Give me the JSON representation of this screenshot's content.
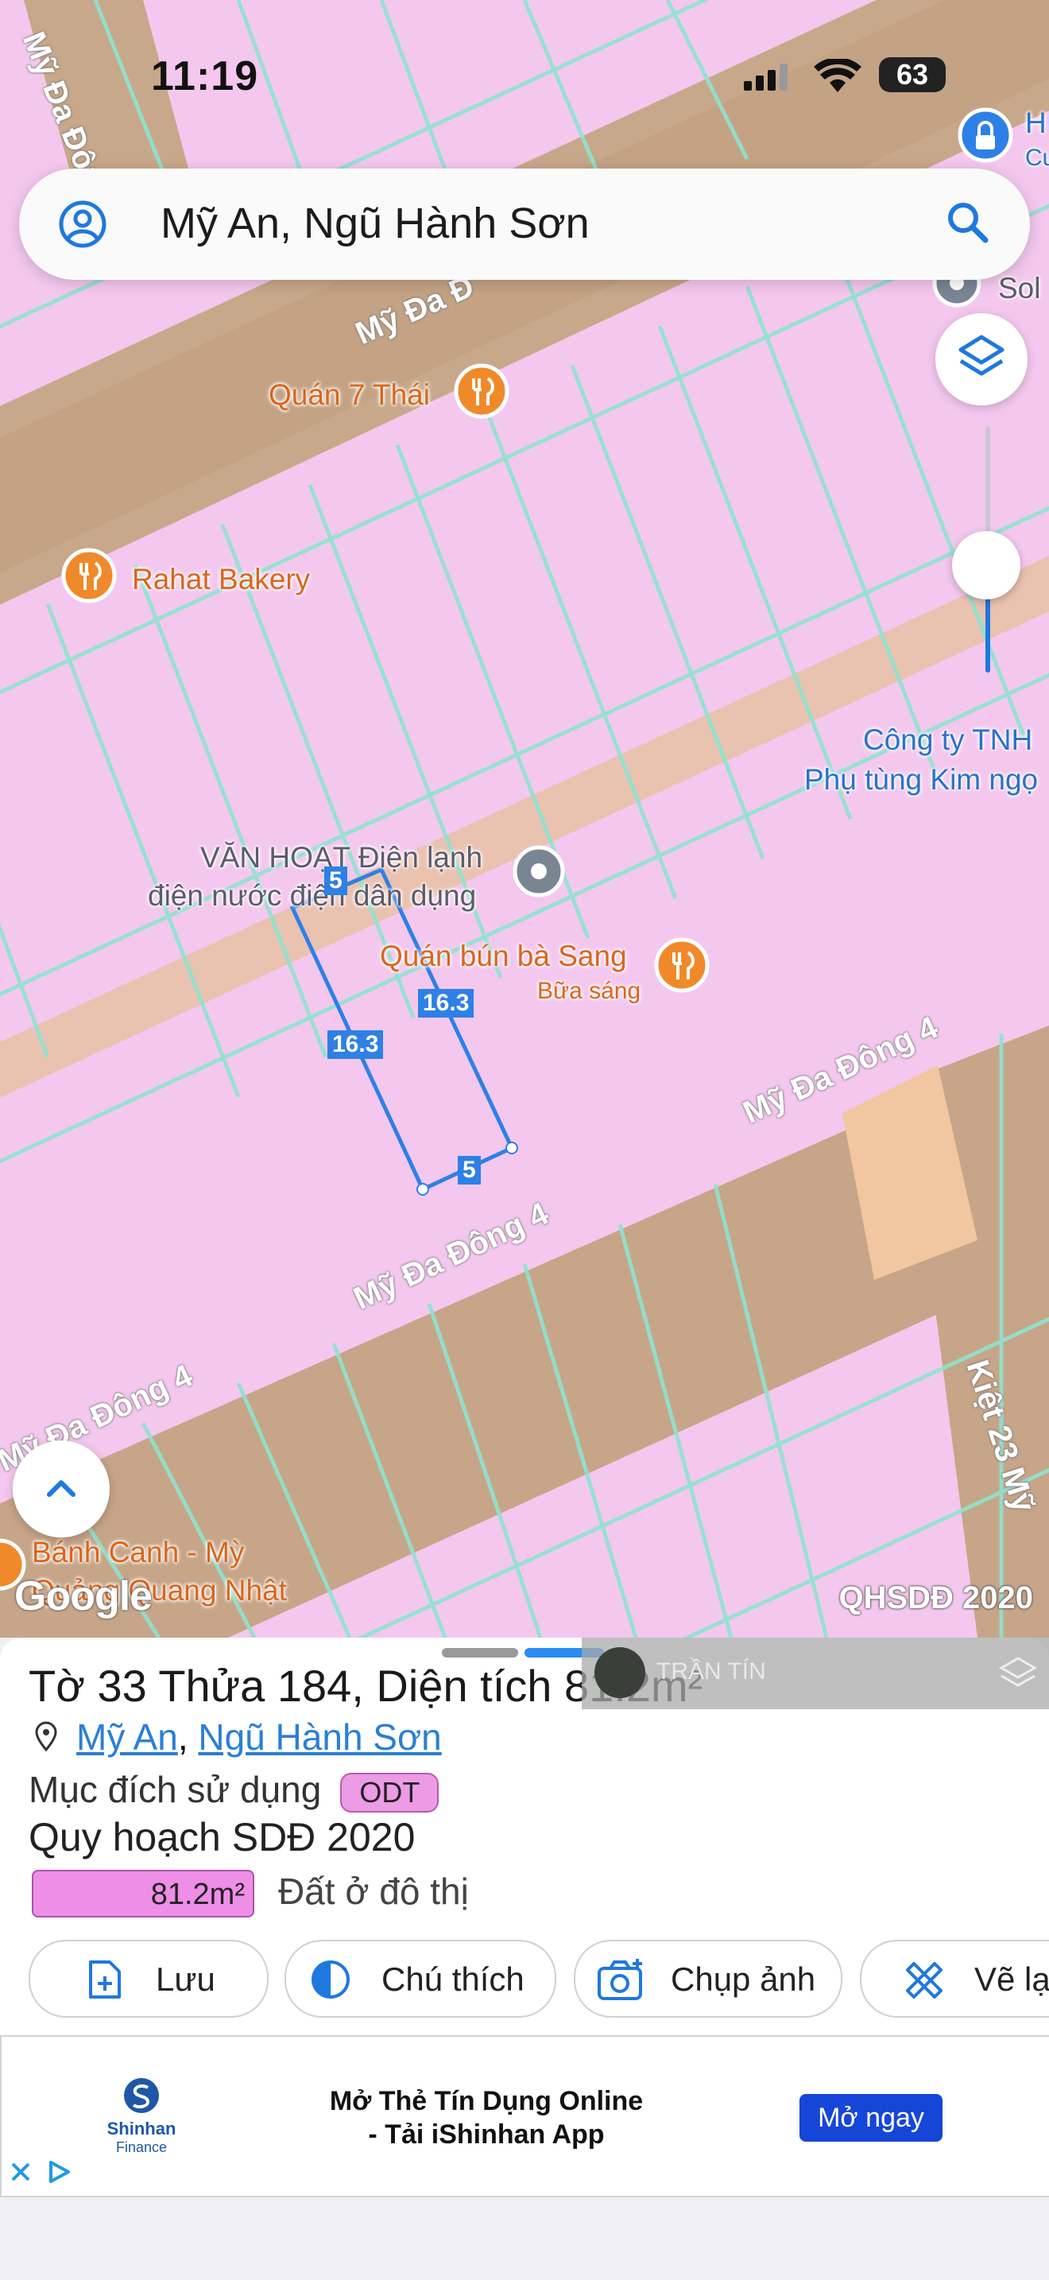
{
  "status_bar": {
    "time": "11:19",
    "battery": "63"
  },
  "search": {
    "query": "Mỹ An, Ngũ Hành Sơn"
  },
  "map": {
    "pois": {
      "quan7thai": "Quán 7 Thái",
      "rahat": "Rahat Bakery",
      "vanhoat_line1": "VĂN HOẠT Điện lạnh",
      "vanhoat_line2": "điện nước điện dân dụng",
      "bunbasang": "Quán bún bà Sang",
      "bunbasang_sub": "Bữa sáng",
      "congty_line1": "Công ty TNH",
      "congty_line2": "Phụ tùng Kim ngọ",
      "banhcanh_line1": "Bánh Canh - Mỳ",
      "banhcanh_line2": "Quảng Quang Nhật",
      "top_right_1": "H",
      "top_right_2": "Cu",
      "sol": "Sol"
    },
    "roads": {
      "myda_top": "Mỹ Đa Đ",
      "myda_left": "Mỹ Đa Đông",
      "mydadong4_a": "Mỹ Đa Đông 4",
      "mydadong4_b": "Mỹ Đa Đông 4",
      "mydadong4_c": "Mỹ Đa Đông 4",
      "kiet": "Kiệt 23 Mỹ"
    },
    "dimensions": {
      "top": "5",
      "left": "16.3",
      "right": "16.3",
      "bottom": "5"
    },
    "google_logo": "Google",
    "layer_label": "QHSDĐ 2020"
  },
  "overlay_user": {
    "name": "TRẦN TÍN"
  },
  "sheet": {
    "title": "Tờ 33 Thửa 184, Diện tích 81.2m²",
    "location_ward": "Mỹ An",
    "location_sep": ", ",
    "location_district": "Ngũ Hành Sơn",
    "purpose_label": "Mục đích sử dụng",
    "purpose_code": "ODT",
    "plan_label": "Quy hoạch SDĐ 2020",
    "area_value": "81.2m²",
    "area_desc": "Đất ở đô thị"
  },
  "actions": {
    "save": "Lưu",
    "legend": "Chú thích",
    "photo": "Chụp ảnh",
    "draw": "Vẽ lạ"
  },
  "ad": {
    "brand": "Shinhan",
    "brand_sub": "Finance",
    "copy_line1": "Mở Thẻ Tín Dụng Online",
    "copy_line2": "- Tải iShinhan App",
    "cta": "Mở ngay"
  },
  "colors": {
    "land": "#f4c8ee",
    "road": "#c9a98c",
    "parcel_line": "#8fe3d0",
    "accent": "#2e80e6",
    "poi_orange": "#f0892a"
  }
}
